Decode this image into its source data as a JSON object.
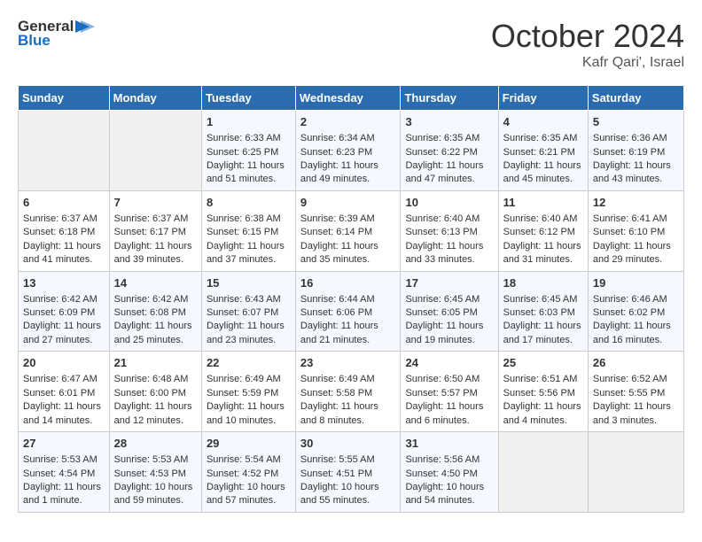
{
  "header": {
    "logo_general": "General",
    "logo_blue": "Blue",
    "month_year": "October 2024",
    "location": "Kafr Qari', Israel"
  },
  "weekdays": [
    "Sunday",
    "Monday",
    "Tuesday",
    "Wednesday",
    "Thursday",
    "Friday",
    "Saturday"
  ],
  "weeks": [
    [
      {
        "day": "",
        "empty": true
      },
      {
        "day": "",
        "empty": true
      },
      {
        "day": "1",
        "sunrise": "Sunrise: 6:33 AM",
        "sunset": "Sunset: 6:25 PM",
        "daylight": "Daylight: 11 hours and 51 minutes."
      },
      {
        "day": "2",
        "sunrise": "Sunrise: 6:34 AM",
        "sunset": "Sunset: 6:23 PM",
        "daylight": "Daylight: 11 hours and 49 minutes."
      },
      {
        "day": "3",
        "sunrise": "Sunrise: 6:35 AM",
        "sunset": "Sunset: 6:22 PM",
        "daylight": "Daylight: 11 hours and 47 minutes."
      },
      {
        "day": "4",
        "sunrise": "Sunrise: 6:35 AM",
        "sunset": "Sunset: 6:21 PM",
        "daylight": "Daylight: 11 hours and 45 minutes."
      },
      {
        "day": "5",
        "sunrise": "Sunrise: 6:36 AM",
        "sunset": "Sunset: 6:19 PM",
        "daylight": "Daylight: 11 hours and 43 minutes."
      }
    ],
    [
      {
        "day": "6",
        "sunrise": "Sunrise: 6:37 AM",
        "sunset": "Sunset: 6:18 PM",
        "daylight": "Daylight: 11 hours and 41 minutes."
      },
      {
        "day": "7",
        "sunrise": "Sunrise: 6:37 AM",
        "sunset": "Sunset: 6:17 PM",
        "daylight": "Daylight: 11 hours and 39 minutes."
      },
      {
        "day": "8",
        "sunrise": "Sunrise: 6:38 AM",
        "sunset": "Sunset: 6:15 PM",
        "daylight": "Daylight: 11 hours and 37 minutes."
      },
      {
        "day": "9",
        "sunrise": "Sunrise: 6:39 AM",
        "sunset": "Sunset: 6:14 PM",
        "daylight": "Daylight: 11 hours and 35 minutes."
      },
      {
        "day": "10",
        "sunrise": "Sunrise: 6:40 AM",
        "sunset": "Sunset: 6:13 PM",
        "daylight": "Daylight: 11 hours and 33 minutes."
      },
      {
        "day": "11",
        "sunrise": "Sunrise: 6:40 AM",
        "sunset": "Sunset: 6:12 PM",
        "daylight": "Daylight: 11 hours and 31 minutes."
      },
      {
        "day": "12",
        "sunrise": "Sunrise: 6:41 AM",
        "sunset": "Sunset: 6:10 PM",
        "daylight": "Daylight: 11 hours and 29 minutes."
      }
    ],
    [
      {
        "day": "13",
        "sunrise": "Sunrise: 6:42 AM",
        "sunset": "Sunset: 6:09 PM",
        "daylight": "Daylight: 11 hours and 27 minutes."
      },
      {
        "day": "14",
        "sunrise": "Sunrise: 6:42 AM",
        "sunset": "Sunset: 6:08 PM",
        "daylight": "Daylight: 11 hours and 25 minutes."
      },
      {
        "day": "15",
        "sunrise": "Sunrise: 6:43 AM",
        "sunset": "Sunset: 6:07 PM",
        "daylight": "Daylight: 11 hours and 23 minutes."
      },
      {
        "day": "16",
        "sunrise": "Sunrise: 6:44 AM",
        "sunset": "Sunset: 6:06 PM",
        "daylight": "Daylight: 11 hours and 21 minutes."
      },
      {
        "day": "17",
        "sunrise": "Sunrise: 6:45 AM",
        "sunset": "Sunset: 6:05 PM",
        "daylight": "Daylight: 11 hours and 19 minutes."
      },
      {
        "day": "18",
        "sunrise": "Sunrise: 6:45 AM",
        "sunset": "Sunset: 6:03 PM",
        "daylight": "Daylight: 11 hours and 17 minutes."
      },
      {
        "day": "19",
        "sunrise": "Sunrise: 6:46 AM",
        "sunset": "Sunset: 6:02 PM",
        "daylight": "Daylight: 11 hours and 16 minutes."
      }
    ],
    [
      {
        "day": "20",
        "sunrise": "Sunrise: 6:47 AM",
        "sunset": "Sunset: 6:01 PM",
        "daylight": "Daylight: 11 hours and 14 minutes."
      },
      {
        "day": "21",
        "sunrise": "Sunrise: 6:48 AM",
        "sunset": "Sunset: 6:00 PM",
        "daylight": "Daylight: 11 hours and 12 minutes."
      },
      {
        "day": "22",
        "sunrise": "Sunrise: 6:49 AM",
        "sunset": "Sunset: 5:59 PM",
        "daylight": "Daylight: 11 hours and 10 minutes."
      },
      {
        "day": "23",
        "sunrise": "Sunrise: 6:49 AM",
        "sunset": "Sunset: 5:58 PM",
        "daylight": "Daylight: 11 hours and 8 minutes."
      },
      {
        "day": "24",
        "sunrise": "Sunrise: 6:50 AM",
        "sunset": "Sunset: 5:57 PM",
        "daylight": "Daylight: 11 hours and 6 minutes."
      },
      {
        "day": "25",
        "sunrise": "Sunrise: 6:51 AM",
        "sunset": "Sunset: 5:56 PM",
        "daylight": "Daylight: 11 hours and 4 minutes."
      },
      {
        "day": "26",
        "sunrise": "Sunrise: 6:52 AM",
        "sunset": "Sunset: 5:55 PM",
        "daylight": "Daylight: 11 hours and 3 minutes."
      }
    ],
    [
      {
        "day": "27",
        "sunrise": "Sunrise: 5:53 AM",
        "sunset": "Sunset: 4:54 PM",
        "daylight": "Daylight: 11 hours and 1 minute."
      },
      {
        "day": "28",
        "sunrise": "Sunrise: 5:53 AM",
        "sunset": "Sunset: 4:53 PM",
        "daylight": "Daylight: 10 hours and 59 minutes."
      },
      {
        "day": "29",
        "sunrise": "Sunrise: 5:54 AM",
        "sunset": "Sunset: 4:52 PM",
        "daylight": "Daylight: 10 hours and 57 minutes."
      },
      {
        "day": "30",
        "sunrise": "Sunrise: 5:55 AM",
        "sunset": "Sunset: 4:51 PM",
        "daylight": "Daylight: 10 hours and 55 minutes."
      },
      {
        "day": "31",
        "sunrise": "Sunrise: 5:56 AM",
        "sunset": "Sunset: 4:50 PM",
        "daylight": "Daylight: 10 hours and 54 minutes."
      },
      {
        "day": "",
        "empty": true
      },
      {
        "day": "",
        "empty": true
      }
    ]
  ]
}
